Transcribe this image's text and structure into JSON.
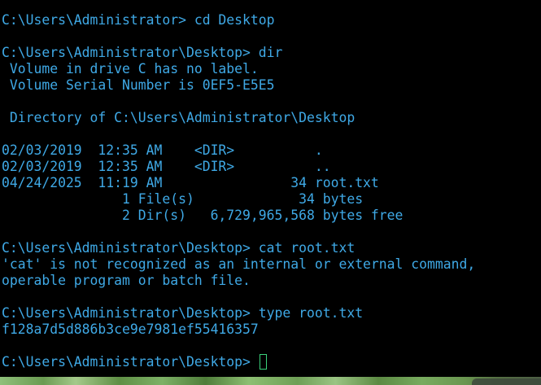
{
  "terminal": {
    "lines": {
      "l0": "C:\\Users\\Administrator> cd Desktop",
      "l1": "",
      "l2": "C:\\Users\\Administrator\\Desktop> dir",
      "l3": " Volume in drive C has no label.",
      "l4": " Volume Serial Number is 0EF5-E5E5",
      "l5": "",
      "l6": " Directory of C:\\Users\\Administrator\\Desktop",
      "l7": "",
      "l8": "02/03/2019  12:35 AM    <DIR>          .",
      "l9": "02/03/2019  12:35 AM    <DIR>          ..",
      "l10": "04/24/2025  11:19 AM                34 root.txt",
      "l11": "               1 File(s)             34 bytes",
      "l12": "               2 Dir(s)   6,729,965,568 bytes free",
      "l13": "",
      "l14": "C:\\Users\\Administrator\\Desktop> cat root.txt",
      "l15": "'cat' is not recognized as an internal or external command,",
      "l16": "operable program or batch file.",
      "l17": "",
      "l18": "C:\\Users\\Administrator\\Desktop> type root.txt",
      "l19": "f128a7d5d886b3ce9e7981ef55416357",
      "l20": "",
      "l21": "C:\\Users\\Administrator\\Desktop> "
    },
    "colors": {
      "text": "#3fa9e6",
      "background": "#000000",
      "cursor": "#3ad17b"
    }
  },
  "icons": {
    "cursor": "block-cursor-outline"
  }
}
